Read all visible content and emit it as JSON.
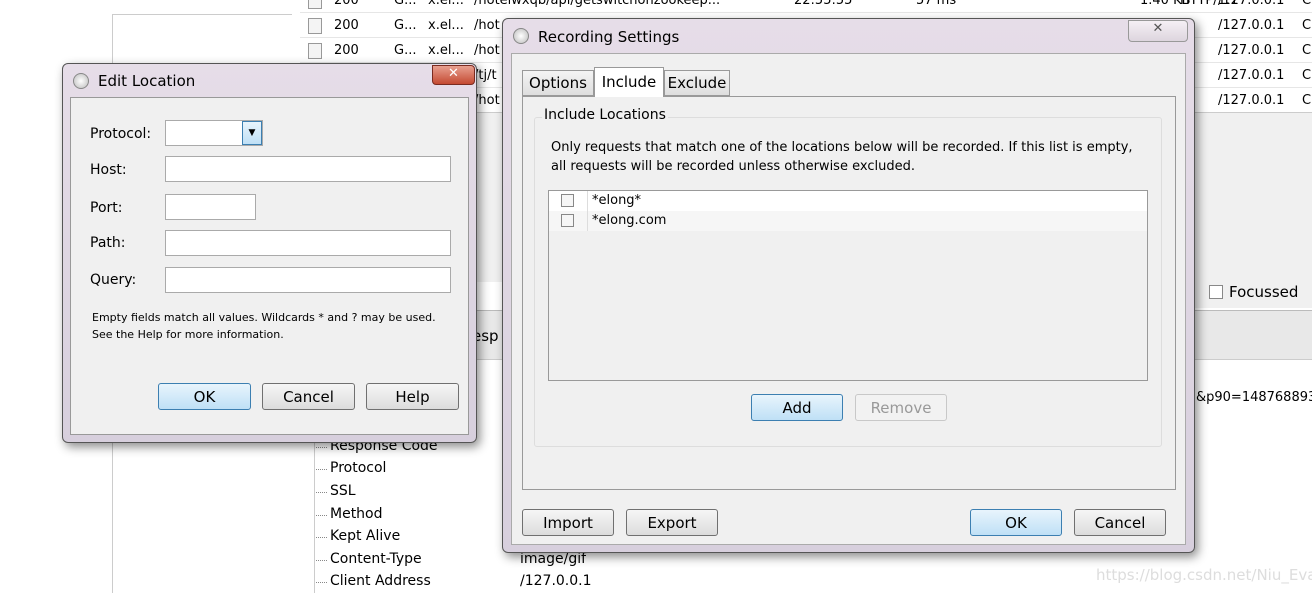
{
  "background": {
    "rows": [
      {
        "result": "200",
        "method": "G...",
        "host": "x.el...",
        "url": "/hotelwxqb/api/getswitchonzookeep...",
        "time": "22:55:55",
        "duration": "57 ms",
        "size": "1.40 KB",
        "protocol": "HTTP/1.1",
        "client": "/127.0.0.1",
        "extra": "C"
      },
      {
        "result": "200",
        "method": "G...",
        "host": "x.el...",
        "url": "/hot",
        "client": "/127.0.0.1",
        "extra": "C"
      },
      {
        "result": "200",
        "method": "G...",
        "host": "x.el...",
        "url": "/hot",
        "client": "/127.0.0.1",
        "extra": "C"
      },
      {
        "result": "",
        "method": "",
        "host": "",
        "url": "/tj/t",
        "client": "/127.0.0.1",
        "extra": "C"
      },
      {
        "result": "",
        "method": "",
        "host": "",
        "url": "/hot",
        "client": "/127.0.0.1",
        "extra": "C"
      }
    ],
    "focussed_label": "Focussed",
    "tab_partial": "esp",
    "query_partial": "&p90=148768893",
    "tree": [
      "Response Code",
      "Protocol",
      "SSL",
      "Method",
      "Kept Alive",
      "Content-Type",
      "Client Address"
    ],
    "values": {
      "content_type": "image/gif",
      "client_address": "/127.0.0.1"
    },
    "watermark": "https://blog.csdn.net/Niu_Eva"
  },
  "edit_location": {
    "title": "Edit Location",
    "fields": {
      "protocol": "Protocol:",
      "host": "Host:",
      "port": "Port:",
      "path": "Path:",
      "query": "Query:"
    },
    "values": {
      "protocol": "",
      "host": "",
      "port": "",
      "path": "",
      "query": ""
    },
    "hint1": "Empty fields match all values. Wildcards * and ? may be used.",
    "hint2": "See the Help for more information.",
    "ok": "OK",
    "cancel": "Cancel",
    "help": "Help"
  },
  "recording_settings": {
    "title": "Recording Settings",
    "tabs": [
      "Options",
      "Include",
      "Exclude"
    ],
    "active_tab": "Include",
    "group_title": "Include Locations",
    "description1": "Only requests that match one of the locations below will be recorded. If this list is empty,",
    "description2": "all requests will be recorded unless otherwise excluded.",
    "locations": [
      {
        "pattern": "*elong*",
        "checked": false
      },
      {
        "pattern": "*elong.com",
        "checked": false
      }
    ],
    "add": "Add",
    "remove": "Remove",
    "import": "Import",
    "export": "Export",
    "ok": "OK",
    "cancel": "Cancel"
  }
}
